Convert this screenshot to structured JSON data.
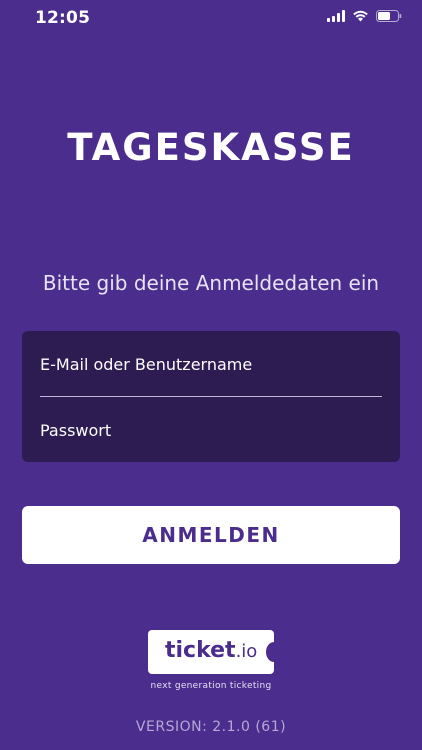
{
  "status_bar": {
    "time": "12:05",
    "icons": [
      "signal-icon",
      "wifi-icon",
      "battery-icon"
    ]
  },
  "app": {
    "title": "TAGESKASSE",
    "subtitle": "Bitte gib deine Anmeldedaten ein"
  },
  "login_form": {
    "email_placeholder": "E-Mail oder Benutzername",
    "email_value": "",
    "password_placeholder": "Passwort",
    "password_value": "",
    "submit_label": "ANMELDEN"
  },
  "branding": {
    "logo_text": "ticket",
    "logo_tld": ".io",
    "tagline": "next generation ticketing"
  },
  "footer": {
    "version": "VERSION: 2.1.0 (61)"
  },
  "colors": {
    "background": "#4a2d8c",
    "card": "#2c1c52",
    "button": "#ffffff",
    "button_text": "#4a2d8c"
  }
}
